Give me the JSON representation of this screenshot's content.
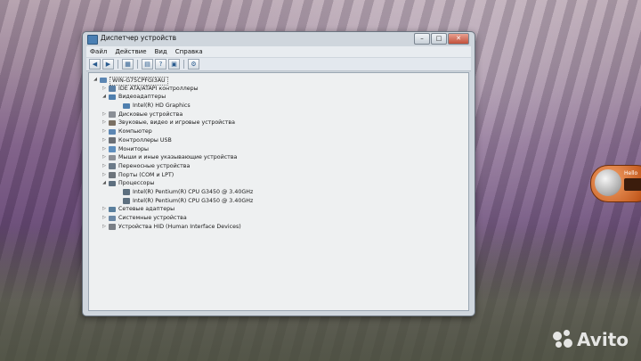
{
  "window": {
    "title": "Диспетчер устройств",
    "controls": {
      "minimize": "–",
      "maximize": "□",
      "close": "✕"
    }
  },
  "menu": [
    "Файл",
    "Действие",
    "Вид",
    "Справка"
  ],
  "toolbar": [
    "back-icon",
    "forward-icon",
    "tree-view-icon",
    "properties-icon",
    "help-icon",
    "scan-hardware-icon",
    "device-icon"
  ],
  "tree": {
    "root": "WIN-G75CPFGI3AU",
    "items": [
      {
        "label": "IDE ATA/ATAPI контроллеры",
        "icon": "ide-controller-icon",
        "color": "#5a7fa5",
        "level": 1,
        "expanded": false
      },
      {
        "label": "Видеоадаптеры",
        "icon": "display-adapter-icon",
        "color": "#4f7fae",
        "level": 1,
        "expanded": true
      },
      {
        "label": "Intel(R) HD Graphics",
        "icon": "display-adapter-icon",
        "color": "#4f7fae",
        "level": 2
      },
      {
        "label": "Дисковые устройства",
        "icon": "disk-drive-icon",
        "color": "#8a8f96",
        "level": 1,
        "expanded": false
      },
      {
        "label": "Звуковые, видео и игровые устройства",
        "icon": "sound-icon",
        "color": "#7a6f62",
        "level": 1,
        "expanded": false
      },
      {
        "label": "Компьютер",
        "icon": "computer-icon",
        "color": "#5b86b3",
        "level": 1,
        "expanded": false
      },
      {
        "label": "Контроллеры USB",
        "icon": "usb-icon",
        "color": "#6a6f76",
        "level": 1,
        "expanded": false
      },
      {
        "label": "Мониторы",
        "icon": "monitor-icon",
        "color": "#5f8fbe",
        "level": 1,
        "expanded": false
      },
      {
        "label": "Мыши и иные указывающие устройства",
        "icon": "mouse-icon",
        "color": "#8c9097",
        "level": 1,
        "expanded": false
      },
      {
        "label": "Переносные устройства",
        "icon": "portable-device-icon",
        "color": "#6b7a89",
        "level": 1,
        "expanded": false
      },
      {
        "label": "Порты (COM и LPT)",
        "icon": "port-icon",
        "color": "#6d747c",
        "level": 1,
        "expanded": false
      },
      {
        "label": "Процессоры",
        "icon": "processor-icon",
        "color": "#5d6f7f",
        "level": 1,
        "expanded": true
      },
      {
        "label": "Intel(R) Pentium(R) CPU G3450 @ 3.40GHz",
        "icon": "processor-icon",
        "color": "#5d6f7f",
        "level": 2
      },
      {
        "label": "Intel(R) Pentium(R) CPU G3450 @ 3.40GHz",
        "icon": "processor-icon",
        "color": "#5d6f7f",
        "level": 2
      },
      {
        "label": "Сетевые адаптеры",
        "icon": "network-icon",
        "color": "#5a7f9d",
        "level": 1,
        "expanded": false
      },
      {
        "label": "Системные устройства",
        "icon": "system-device-icon",
        "color": "#6b88a5",
        "level": 1,
        "expanded": false
      },
      {
        "label": "Устройства HID (Human Interface Devices)",
        "icon": "hid-icon",
        "color": "#7a7f86",
        "level": 1,
        "expanded": false
      }
    ]
  },
  "gadget": {
    "text": "Hello"
  },
  "watermark": {
    "text": "Avito"
  }
}
